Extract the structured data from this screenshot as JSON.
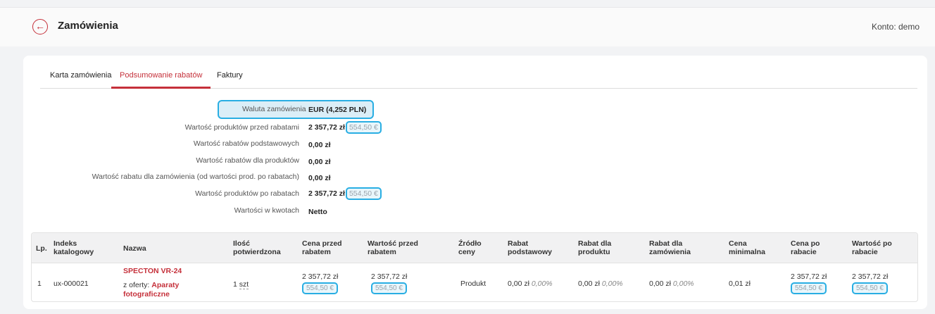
{
  "header": {
    "back_icon": "arrow-left-icon",
    "title": "Zamówienia",
    "account": "Konto: demo"
  },
  "tabs": [
    {
      "label": "Karta zamówienia"
    },
    {
      "label": "Podsumowanie rabatów"
    },
    {
      "label": "Faktury"
    }
  ],
  "summary": {
    "currency": {
      "label": "Waluta zamówienia",
      "value": "EUR (4,252 PLN)"
    },
    "before": {
      "label": "Wartość produktów przed rabatami",
      "value": "2 357,72 zł",
      "eur": "554,50 €"
    },
    "basic": {
      "label": "Wartość rabatów podstawowych",
      "value": "0,00 zł"
    },
    "product": {
      "label": "Wartość rabatów dla produktów",
      "value": "0,00 zł"
    },
    "order": {
      "label": "Wartość rabatu dla zamówienia (od wartości prod. po rabatach)",
      "value": "0,00 zł"
    },
    "after": {
      "label": "Wartość produktów po rabatach",
      "value": "2 357,72 zł",
      "eur": "554,50 €"
    },
    "amounts": {
      "label": "Wartości w kwotach",
      "value": "Netto"
    }
  },
  "table": {
    "headers": [
      "Lp.",
      "Indeks katalogowy",
      "Nazwa",
      "Ilość potwierdzona",
      "Cena przed rabatem",
      "Wartość przed rabatem",
      "Źródło ceny",
      "Rabat podstawowy",
      "Rabat dla produktu",
      "Rabat dla zamówienia",
      "Cena minimalna",
      "Cena po rabacie",
      "Wartość po rabacie"
    ],
    "row": {
      "lp": "1",
      "index": "ux-000021",
      "name": "SPECTON VR-24",
      "offer_prefix": "z oferty: ",
      "offer_link": "Aparaty fotograficzne",
      "qty": "1",
      "unit": "szt",
      "price_before": "2 357,72 zł",
      "price_before_eur": "554,50 €",
      "value_before": "2 357,72 zł",
      "value_before_eur": "554,50 €",
      "source": "Produkt",
      "basic_amount": "0,00 zł",
      "basic_pct": "0,00%",
      "product_amount": "0,00 zł",
      "product_pct": "0,00%",
      "order_amount": "0,00 zł",
      "order_pct": "0,00%",
      "min_price": "0,01 zł",
      "price_after": "2 357,72 zł",
      "price_after_eur": "554,50 €",
      "value_after": "2 357,72 zł",
      "value_after_eur": "554,50 €"
    }
  },
  "colors": {
    "accent": "#c5303a",
    "highlight": "#29aee3"
  }
}
